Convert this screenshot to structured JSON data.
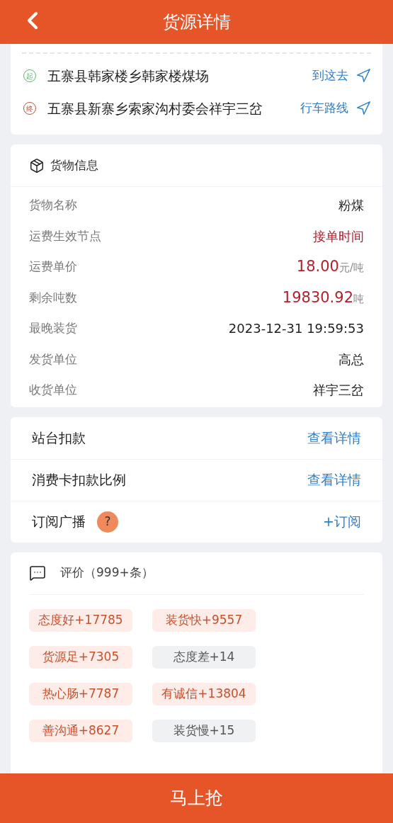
{
  "header": {
    "title": "货源详情"
  },
  "route": {
    "stops": [
      {
        "kind": "start",
        "badge": "起",
        "address": "五寨县韩家楼乡韩家楼煤场",
        "action": "到这去"
      },
      {
        "kind": "end",
        "badge": "终",
        "address": "五寨县新寨乡索家沟村委会祥宇三岔",
        "action": "行车路线"
      }
    ]
  },
  "cargo": {
    "title": "货物信息",
    "rows": [
      {
        "label": "货物名称",
        "value": "粉煤",
        "emphasis": false
      },
      {
        "label": "运费生效节点",
        "value": "接单时间",
        "emphasis": true
      },
      {
        "label": "运费单价",
        "value": "18.00",
        "unit": "元/吨",
        "emphasis": true
      },
      {
        "label": "剩余吨数",
        "value": "19830.92",
        "unit": "吨",
        "emphasis": true
      },
      {
        "label": "最晚装货",
        "value": "2023-12-31 19:59:53",
        "emphasis": false
      },
      {
        "label": "发货单位",
        "value": "高总",
        "emphasis": false
      },
      {
        "label": "收货单位",
        "value": "祥宇三岔",
        "emphasis": false
      }
    ]
  },
  "actions": [
    {
      "label": "站台扣款",
      "link": "查看详情"
    },
    {
      "label": "消费卡扣款比例",
      "link": "查看详情"
    },
    {
      "label": "订阅广播",
      "help_mark": "?",
      "link": "+订阅"
    }
  ],
  "reviews": {
    "title": "评价（999+条）",
    "tags": [
      {
        "text": "态度好+17785",
        "kind": "positive"
      },
      {
        "text": "装货快+9557",
        "kind": "positive"
      },
      {
        "text": "货源足+7305",
        "kind": "positive"
      },
      {
        "text": "态度差+14",
        "kind": "negative"
      },
      {
        "text": "热心肠+7787",
        "kind": "positive"
      },
      {
        "text": "有诚信+13804",
        "kind": "positive"
      },
      {
        "text": "善沟通+8627",
        "kind": "positive"
      },
      {
        "text": "装货慢+15",
        "kind": "negative"
      }
    ]
  },
  "footer": {
    "button": "马上抢"
  }
}
